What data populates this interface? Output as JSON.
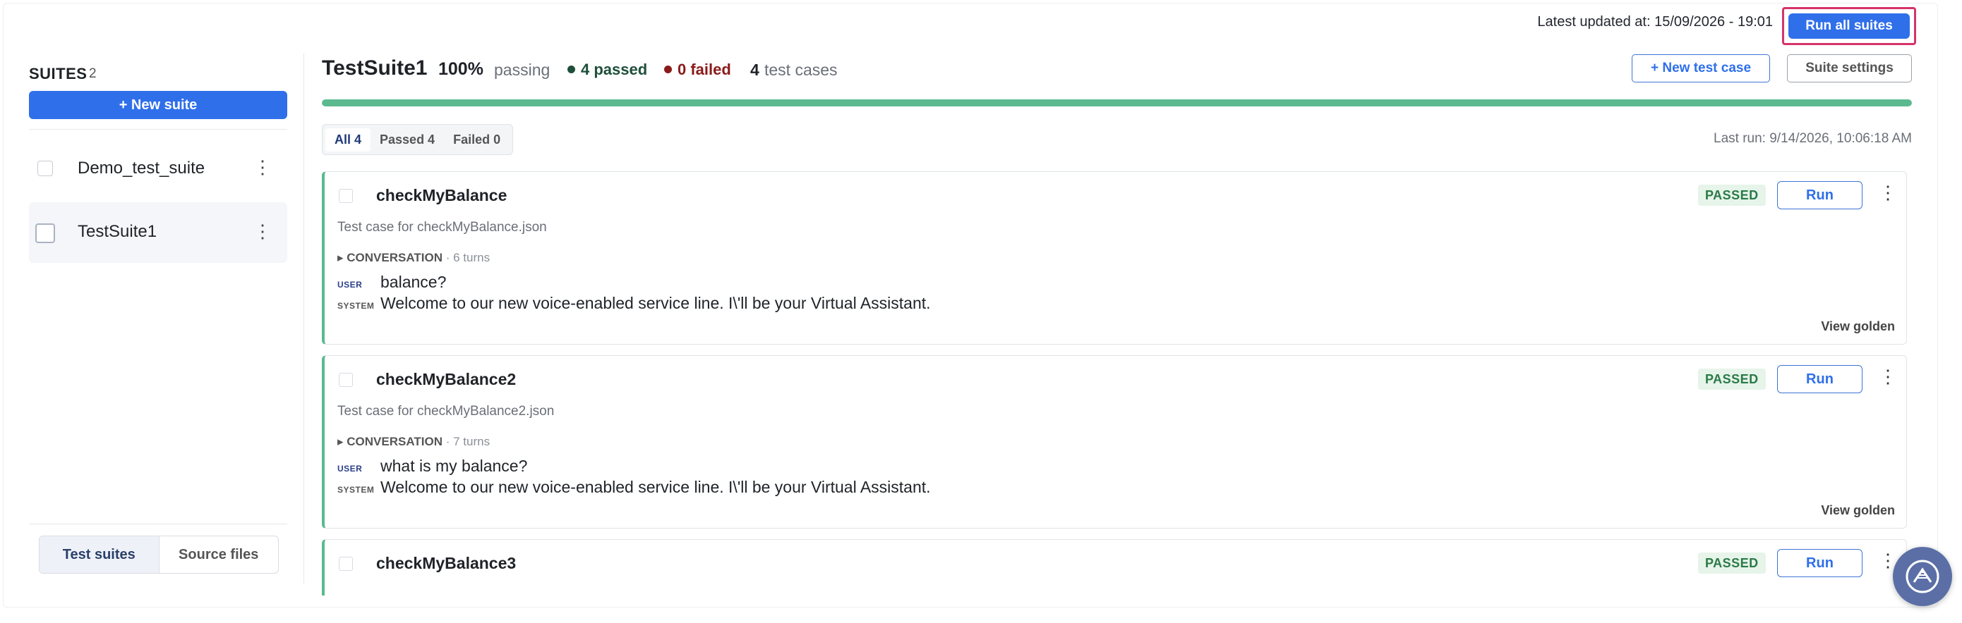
{
  "topbar": {
    "updated": "Latest updated at: 15/09/2026 - 19:01",
    "run_all": "Run all suites"
  },
  "sidebar": {
    "title": "SUITES",
    "count": "2",
    "new_suite": "+ New suite",
    "suites": [
      {
        "name": "Demo_test_suite"
      },
      {
        "name": "TestSuite1"
      }
    ],
    "tabs": [
      "Test suites",
      "Source files"
    ]
  },
  "main": {
    "title": "TestSuite1",
    "percent": "100%",
    "passing_label": "passing",
    "passed": "4 passed",
    "failed": "0 failed",
    "cases_count": "4",
    "cases_label": "test cases",
    "new_case": "+ New test case",
    "settings": "Suite settings",
    "progress": 1.0,
    "filters": [
      "All 4",
      "Passed 4",
      "Failed 0"
    ],
    "last_run": "Last run: 9/14/2026, 10:06:18 AM",
    "status_colors": {
      "passed": "#1e4f3a",
      "failed": "#8b1a1a",
      "progress": "#5bb98f"
    }
  },
  "cases": [
    {
      "name": "checkMyBalance",
      "desc": "Test case for checkMyBalance.json",
      "conv": "CONVERSATION",
      "turns": "· 6 turns",
      "user_role": "USER",
      "user_msg": "balance?",
      "sys_role": "SYSTEM",
      "sys_msg": "Welcome to our new voice-enabled service line. I\\'ll be your Virtual Assistant.",
      "status": "PASSED",
      "run": "Run",
      "golden": "View golden"
    },
    {
      "name": "checkMyBalance2",
      "desc": "Test case for checkMyBalance2.json",
      "conv": "CONVERSATION",
      "turns": "· 7 turns",
      "user_role": "USER",
      "user_msg": "what is my balance?",
      "sys_role": "SYSTEM",
      "sys_msg": "Welcome to our new voice-enabled service line. I\\'ll be your Virtual Assistant.",
      "status": "PASSED",
      "run": "Run",
      "golden": "View golden"
    },
    {
      "name": "checkMyBalance3",
      "status": "PASSED",
      "run": "Run"
    }
  ]
}
